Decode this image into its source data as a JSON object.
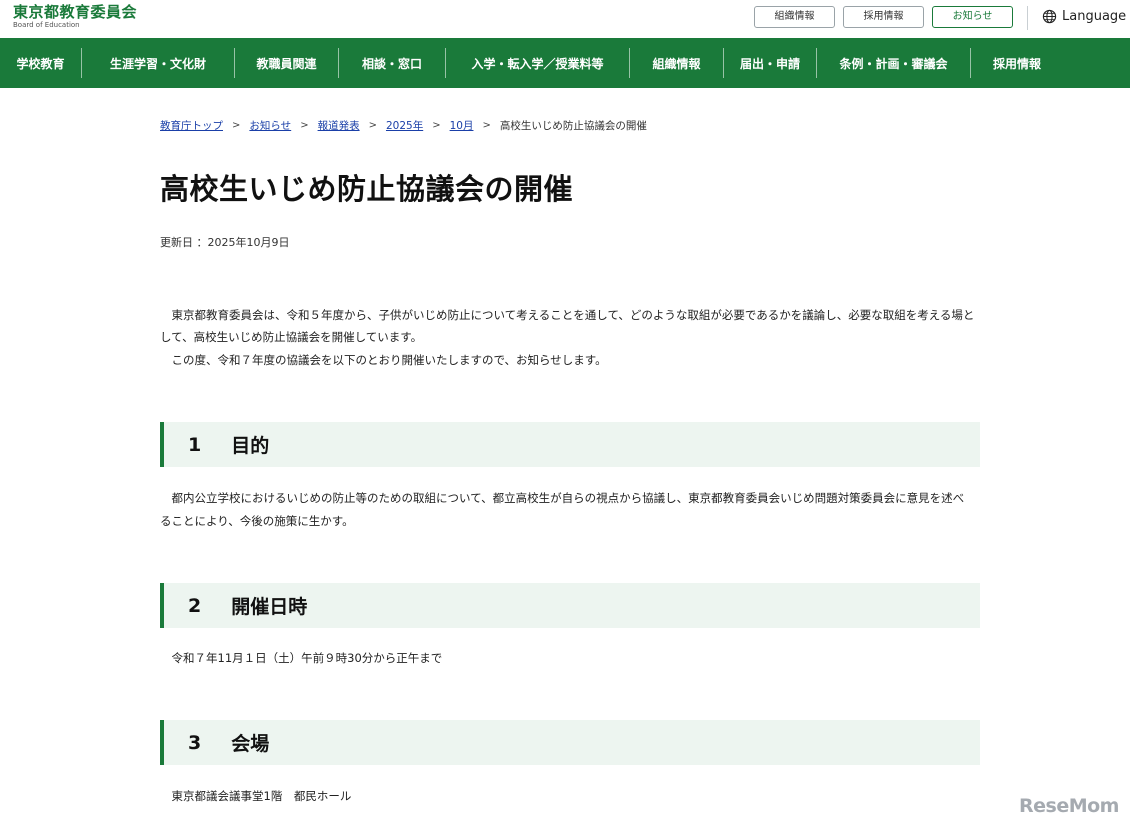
{
  "header": {
    "logo_title": "東京都教育委員会",
    "logo_subtitle": "Board of Education",
    "buttons": [
      {
        "label": "組織情報"
      },
      {
        "label": "採用情報"
      },
      {
        "label": "お知らせ"
      }
    ],
    "language_label": "Language",
    "language_icon": "globe-icon"
  },
  "nav": {
    "items": [
      {
        "label": "学校教育"
      },
      {
        "label": "生涯学習・文化財"
      },
      {
        "label": "教職員関連"
      },
      {
        "label": "相談・窓口"
      },
      {
        "label": "入学・転入学／授業料等"
      },
      {
        "label": "組織情報"
      },
      {
        "label": "届出・申請"
      },
      {
        "label": "条例・計画・審議会"
      },
      {
        "label": "採用情報"
      }
    ]
  },
  "breadcrumb": {
    "items": [
      {
        "label": "教育庁トップ"
      },
      {
        "label": "お知らせ"
      },
      {
        "label": "報道発表"
      },
      {
        "label": "2025年"
      },
      {
        "label": "10月"
      }
    ],
    "current": "高校生いじめ防止協議会の開催"
  },
  "page": {
    "title": "高校生いじめ防止協議会の開催",
    "updated": "更新日 ：2025年10月9日",
    "intro_1": "東京都教育委員会は、令和５年度から、子供がいじめ防止について考えることを通して、どのような取組が必要であるかを議論し、必要な取組を考える場として、高校生いじめ防止協議会を開催しています。",
    "intro_2": "この度、令和７年度の協議会を以下のとおり開催いたしますので、お知らせします。"
  },
  "sections": [
    {
      "number": "1",
      "title": "目的",
      "body": "都内公立学校におけるいじめの防止等のための取組について、都立高校生が自らの視点から協議し、東京都教育委員会いじめ問題対策委員会に意見を述べることにより、今後の施策に生かす。"
    },
    {
      "number": "2",
      "title": "開催日時",
      "body": "令和７年11月１日（土）午前９時30分から正午まで"
    },
    {
      "number": "3",
      "title": "会場",
      "body": "東京都議会議事堂1階　都民ホール"
    }
  ],
  "watermark": "ReseMom",
  "colors": {
    "brand_green": "#1a7a3a",
    "section_bg": "#edf5f0",
    "link_blue": "#1a3fa8"
  }
}
